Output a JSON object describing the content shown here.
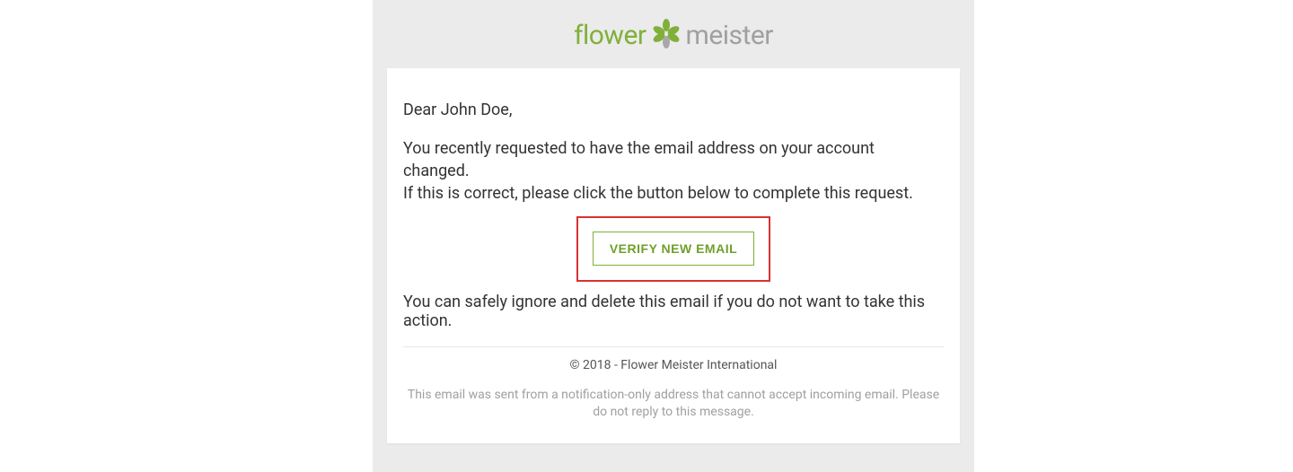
{
  "logo": {
    "part1": "flower",
    "part2": "meister"
  },
  "greeting": "Dear John Doe,",
  "message_line1": "You recently requested to have the email address on your account changed.",
  "message_line2": "If this is correct, please click the button below to complete this request.",
  "verify_button_label": "VERIFY NEW EMAIL",
  "ignore_text": "You can safely ignore and delete this email if you do not want to take this action.",
  "copyright": "© 2018 - Flower Meister International",
  "disclaimer": "This email was sent from a notification-only address that cannot accept incoming email. Please do not reply to this message."
}
